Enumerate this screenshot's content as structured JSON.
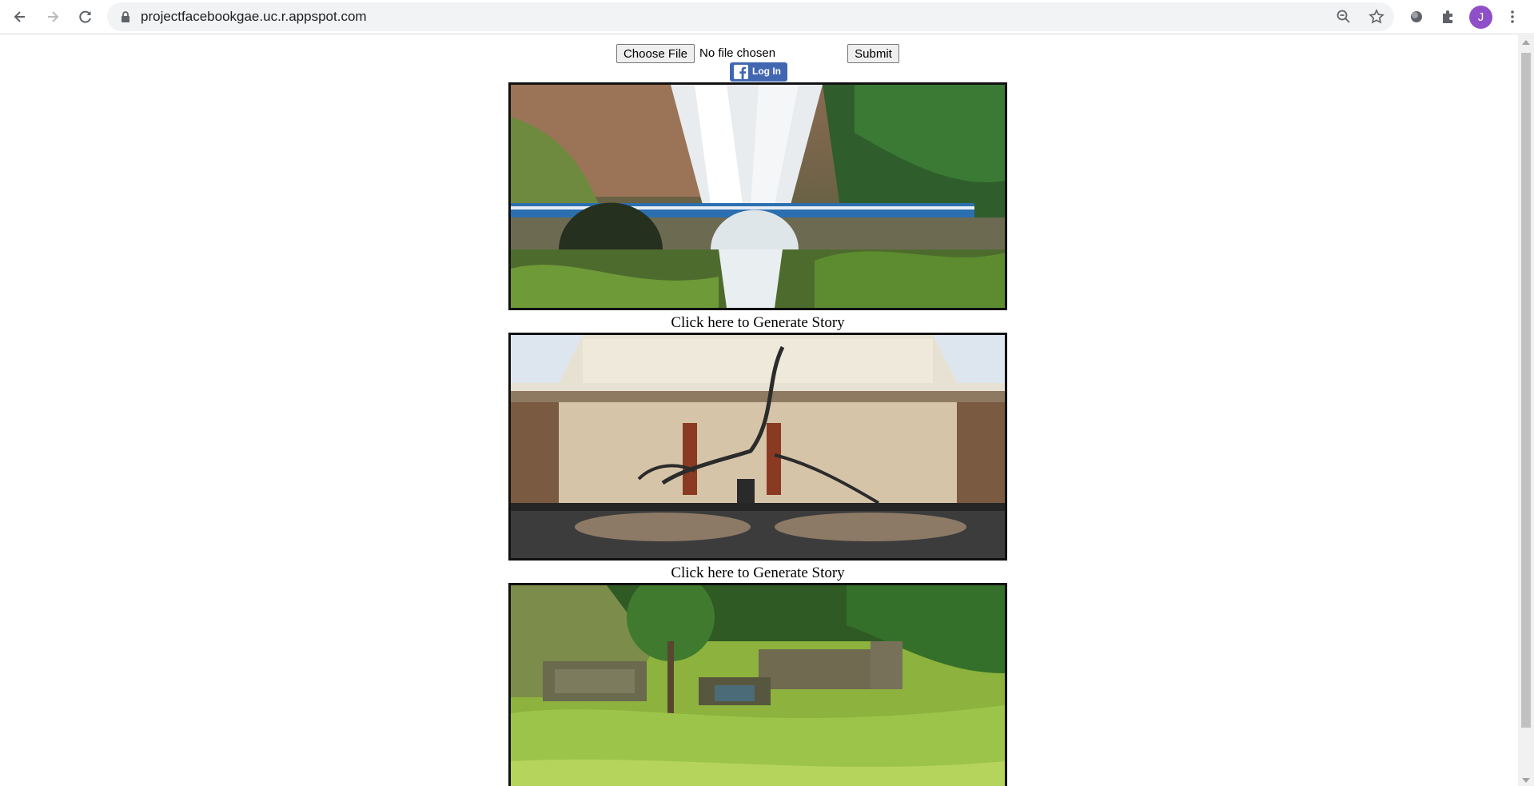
{
  "browser": {
    "url": "projectfacebookgae.uc.r.appspot.com",
    "avatar_letter": "J"
  },
  "form": {
    "choose_file_label": "Choose File",
    "file_status": "No file chosen",
    "submit_label": "Submit"
  },
  "facebook": {
    "login_label": "Log In",
    "brand_color": "#4267b2"
  },
  "gallery": {
    "items": [
      {
        "caption": "Click here to Generate Story"
      },
      {
        "caption": "Click here to Generate Story"
      }
    ]
  }
}
